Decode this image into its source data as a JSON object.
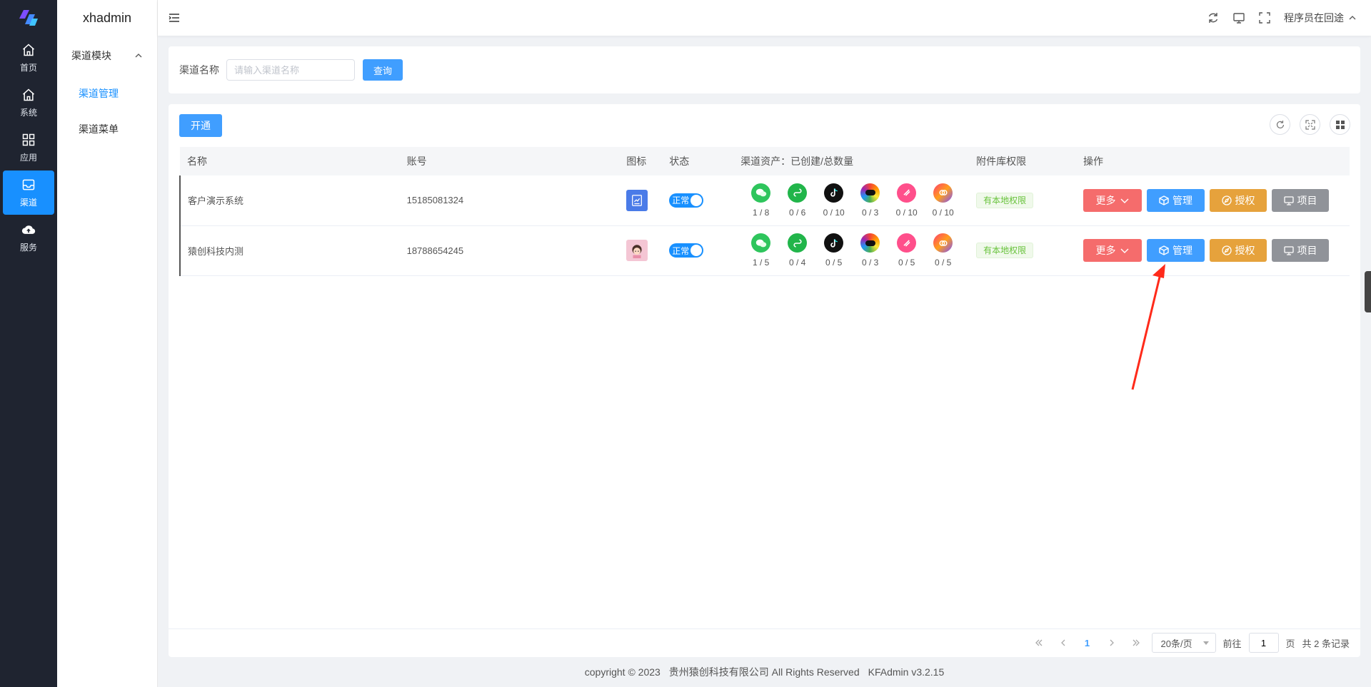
{
  "rail": {
    "items": [
      {
        "label": "首页",
        "icon": "home-icon"
      },
      {
        "label": "系统",
        "icon": "home-icon"
      },
      {
        "label": "应用",
        "icon": "grid-icon"
      },
      {
        "label": "渠道",
        "icon": "inbox-icon",
        "active": true
      },
      {
        "label": "服务",
        "icon": "cloud-upload-icon"
      }
    ]
  },
  "submenu": {
    "title": "xhadmin",
    "group": "渠道模块",
    "items": [
      {
        "label": "渠道管理",
        "active": true
      },
      {
        "label": "渠道菜单"
      }
    ]
  },
  "topbar": {
    "user": "程序员在回途"
  },
  "search": {
    "label": "渠道名称",
    "placeholder": "请输入渠道名称",
    "button": "查询"
  },
  "toolbar": {
    "open_button": "开通"
  },
  "table": {
    "headers": {
      "name": "名称",
      "account": "账号",
      "icon": "图标",
      "status": "状态",
      "assets": "渠道资产：已创建/总数量",
      "permission": "附件库权限",
      "actions": "操作"
    },
    "rows": [
      {
        "name": "客户演示系统",
        "account": "15185081324",
        "status": "正常",
        "assets": [
          "1 / 8",
          "0 / 6",
          "0 / 10",
          "0 / 3",
          "0 / 10",
          "0 / 10"
        ],
        "permission": "有本地权限"
      },
      {
        "name": "猿创科技内测",
        "account": "18788654245",
        "status": "正常",
        "assets": [
          "1 / 5",
          "0 / 4",
          "0 / 5",
          "0 / 3",
          "0 / 5",
          "0 / 5"
        ],
        "permission": "有本地权限"
      }
    ],
    "actions": {
      "more": "更多",
      "manage": "管理",
      "authorize": "授权",
      "project": "项目"
    }
  },
  "pagination": {
    "current_page": "1",
    "page_size": "20条/页",
    "goto_prefix": "前往",
    "goto_value": "1",
    "goto_suffix": "页",
    "total": "共 2 条记录"
  },
  "footer": {
    "copyright": "copyright © 2023",
    "company": "贵州猿创科技有限公司 All Rights Reserved",
    "version": "KFAdmin v3.2.15"
  },
  "colors": {
    "primary": "#409eff",
    "rail_bg": "#1f2430",
    "danger": "#f56c6c",
    "warning": "#e6a23c",
    "info": "#909399",
    "success": "#67c23a"
  }
}
